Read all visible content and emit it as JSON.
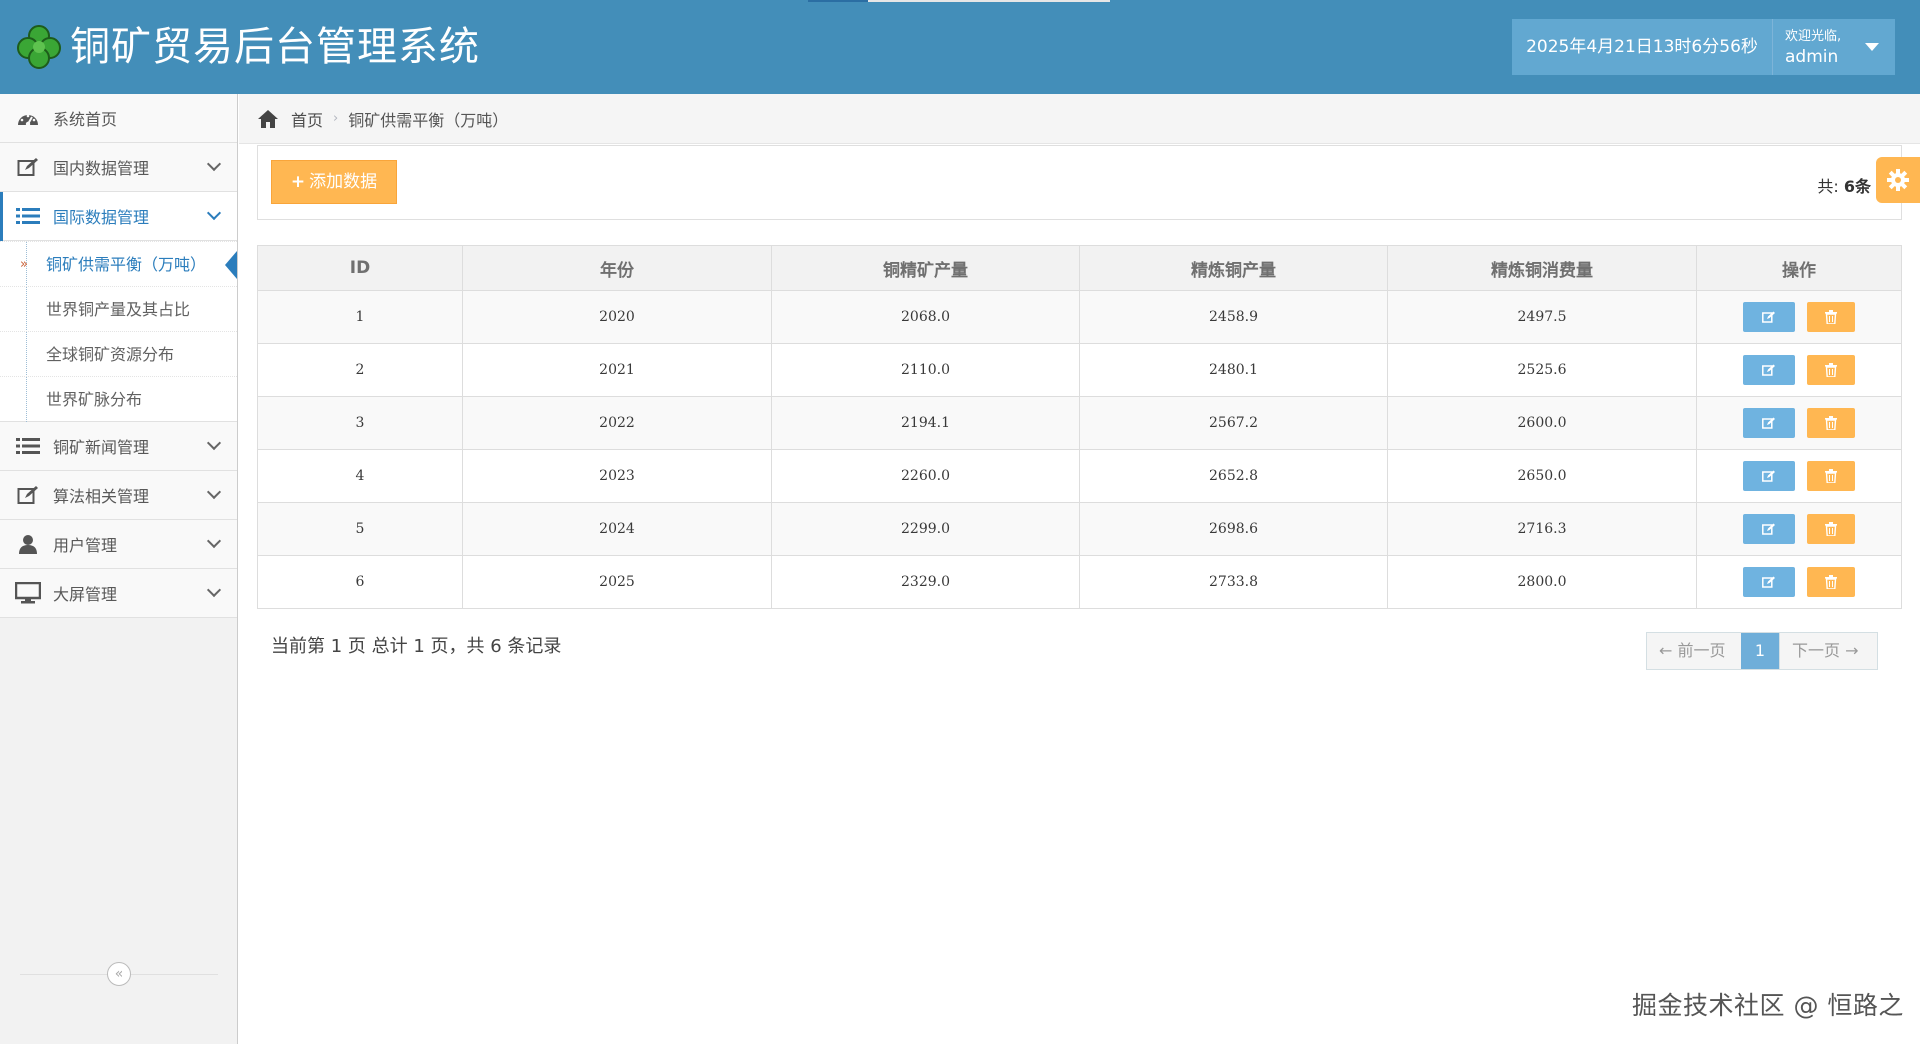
{
  "header": {
    "title": "铜矿贸易后台管理系统",
    "datetime": "2025年4月21日13时6分56秒",
    "welcome": "欢迎光临,",
    "username": "admin"
  },
  "sidebar": {
    "items": [
      {
        "label": "系统首页",
        "icon": "dashboard-icon"
      },
      {
        "label": "国内数据管理",
        "icon": "edit-icon"
      },
      {
        "label": "国际数据管理",
        "icon": "list-icon"
      },
      {
        "label": "铜矿新闻管理",
        "icon": "list-icon"
      },
      {
        "label": "算法相关管理",
        "icon": "edit-icon"
      },
      {
        "label": "用户管理",
        "icon": "user-icon"
      },
      {
        "label": "大屏管理",
        "icon": "desktop-icon"
      }
    ],
    "submenu": [
      "铜矿供需平衡（万吨）",
      "世界铜产量及其占比",
      "全球铜矿资源分布",
      "世界矿脉分布"
    ],
    "collapse_symbol": "«"
  },
  "breadcrumb": {
    "home": "首页",
    "current": "铜矿供需平衡（万吨）"
  },
  "toolbar": {
    "add_label": "添加数据",
    "total_prefix": "共:",
    "total_count": "6条"
  },
  "table": {
    "headers": [
      "ID",
      "年份",
      "铜精矿产量",
      "精炼铜产量",
      "精炼铜消费量",
      "操作"
    ],
    "rows": [
      [
        "1",
        "2020",
        "2068.0",
        "2458.9",
        "2497.5"
      ],
      [
        "2",
        "2021",
        "2110.0",
        "2480.1",
        "2525.6"
      ],
      [
        "3",
        "2022",
        "2194.1",
        "2567.2",
        "2600.0"
      ],
      [
        "4",
        "2023",
        "2260.0",
        "2652.8",
        "2650.0"
      ],
      [
        "5",
        "2024",
        "2299.0",
        "2698.6",
        "2716.3"
      ],
      [
        "6",
        "2025",
        "2329.0",
        "2733.8",
        "2800.0"
      ]
    ]
  },
  "pagination": {
    "info": "当前第 1 页 总计 1 页，共 6 条记录",
    "prev": "← 前一页",
    "current": "1",
    "next": "下一页 →"
  },
  "watermark": "掘金技术社区 @ 恒路之",
  "colors": {
    "header": "#438eb9",
    "accent": "#2b7dbc",
    "warning": "#ffb752",
    "info": "#6fb3e0"
  }
}
